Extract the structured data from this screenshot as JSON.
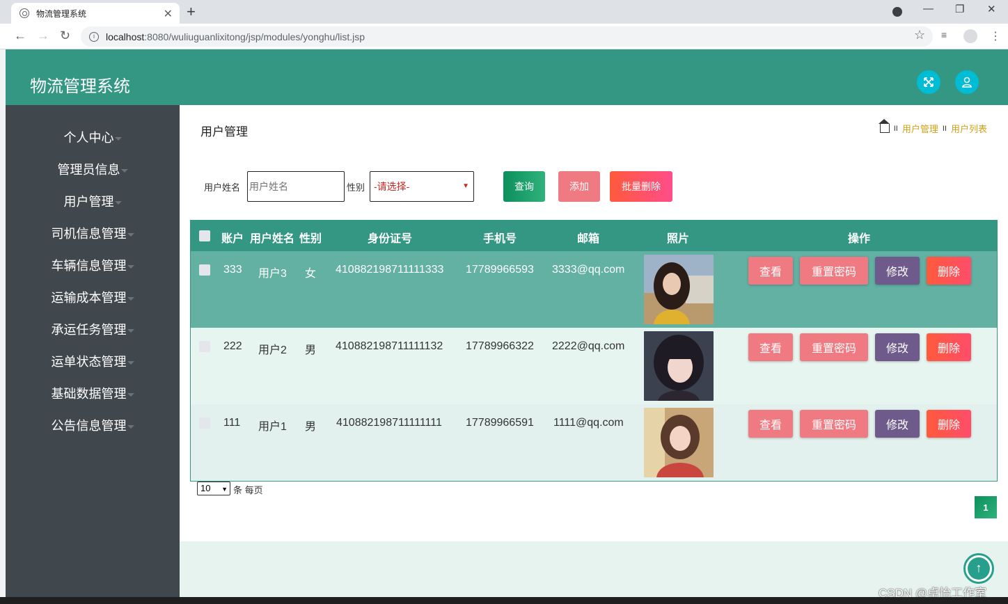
{
  "browser": {
    "tab_title": "物流管理系统",
    "tab_close": "✕",
    "new_tab": "+",
    "url_host": "localhost",
    "url_path": ":8080/wuliuguanlixitong/jsp/modules/yonghu/list.jsp",
    "back_icon": "←",
    "forward_icon": "→",
    "reload_icon": "↻",
    "star_icon": "☆",
    "minimize": "—",
    "restore": "❐",
    "close": "✕"
  },
  "header": {
    "title": "物流管理系统",
    "fullscreen_icon": "⤧",
    "user_icon": "👤"
  },
  "sidebar": {
    "items": [
      {
        "label": "个人中心"
      },
      {
        "label": "管理员信息"
      },
      {
        "label": "用户管理"
      },
      {
        "label": "司机信息管理"
      },
      {
        "label": "车辆信息管理"
      },
      {
        "label": "运输成本管理"
      },
      {
        "label": "承运任务管理"
      },
      {
        "label": "运单状态管理"
      },
      {
        "label": "基础数据管理"
      },
      {
        "label": "公告信息管理"
      }
    ]
  },
  "page": {
    "title": "用户管理",
    "breadcrumb": [
      "用户管理",
      "用户列表"
    ],
    "breadcrumb_sep": "II"
  },
  "search": {
    "name_label": "用户姓名",
    "name_placeholder": "用户姓名",
    "gender_label": "性别",
    "gender_selected": "-请选择-",
    "query_button": "查询",
    "add_button": "添加",
    "batch_delete_button": "批量删除"
  },
  "table": {
    "headers": [
      "账户",
      "用户姓名",
      "性别",
      "身份证号",
      "手机号",
      "邮箱",
      "照片",
      "操作"
    ],
    "rows": [
      {
        "account": "333",
        "name": "用户3",
        "gender": "女",
        "id_number": "410882198711111333",
        "phone": "17789966593",
        "email": "3333@qq.com"
      },
      {
        "account": "222",
        "name": "用户2",
        "gender": "男",
        "id_number": "410882198711111132",
        "phone": "17789966322",
        "email": "2222@qq.com"
      },
      {
        "account": "111",
        "name": "用户1",
        "gender": "男",
        "id_number": "410882198711111111",
        "phone": "17789966591",
        "email": "1111@qq.com"
      }
    ],
    "actions": {
      "view": "查看",
      "reset_password": "重置密码",
      "edit": "修改",
      "delete": "删除"
    }
  },
  "pagination": {
    "page_size": "10",
    "page_size_suffix": "条 每页",
    "current_page": "1"
  },
  "scroll_top_icon": "↑",
  "watermark": "CSDN @卓怡工作室",
  "colors": {
    "primary": "#339784",
    "sidebar": "#41484d",
    "row_highlight": "#62b1a3",
    "row_light": "#e6f5ef"
  }
}
